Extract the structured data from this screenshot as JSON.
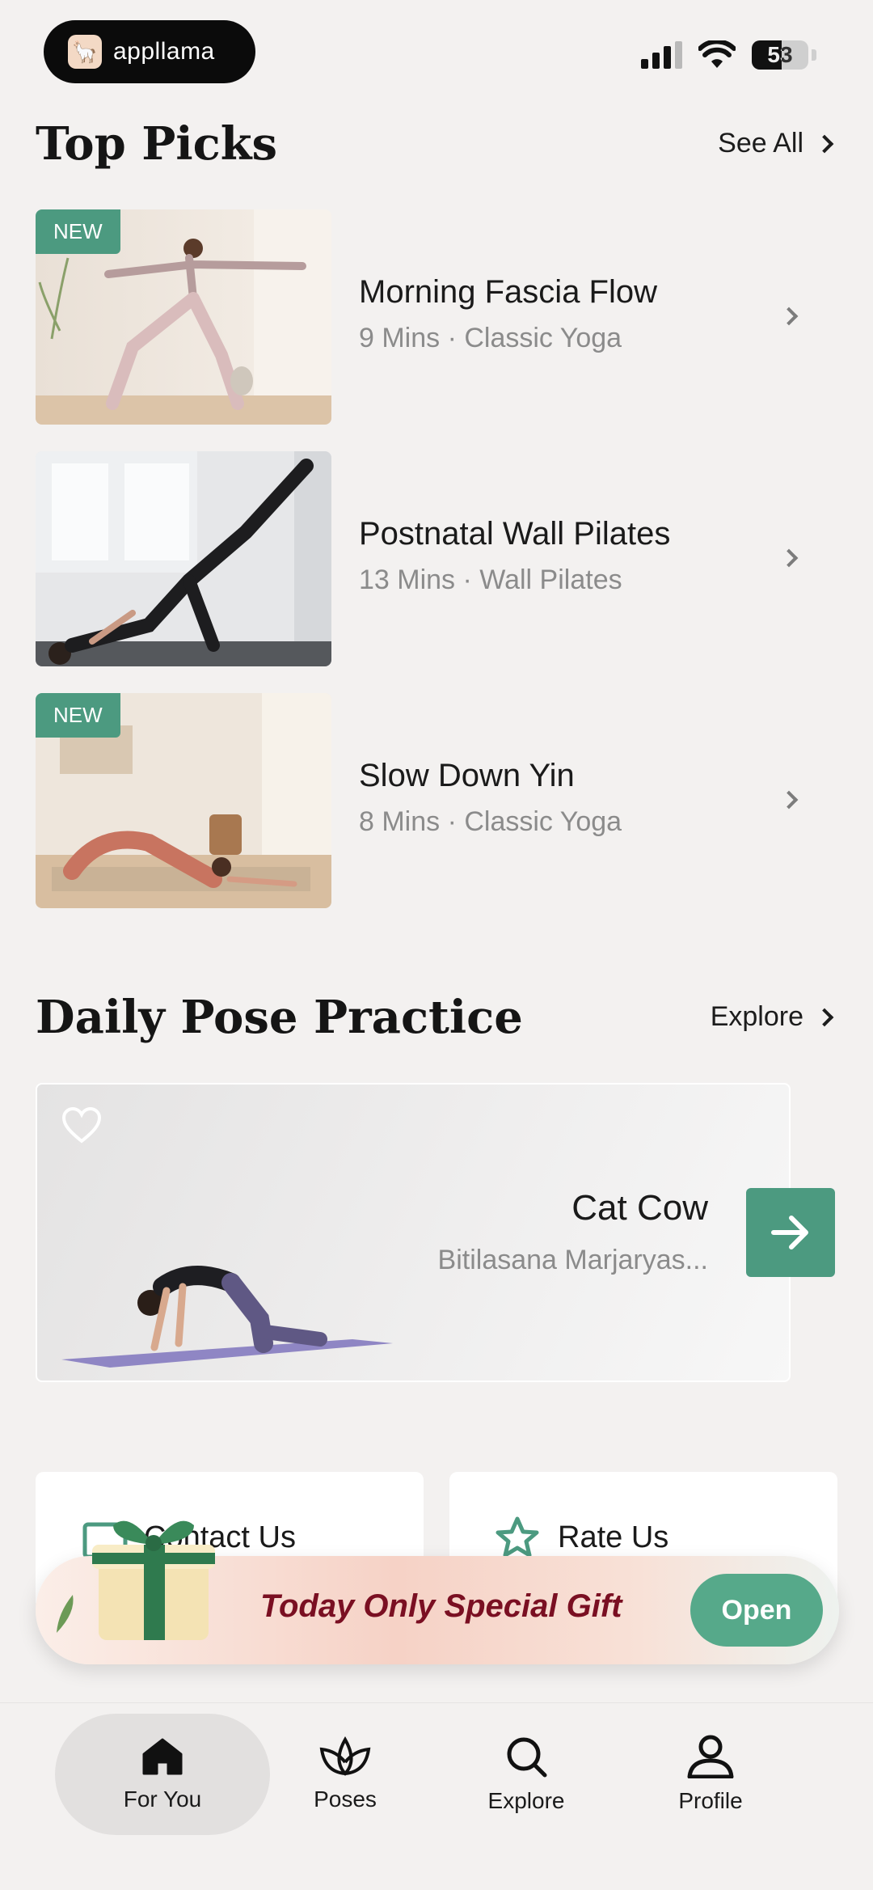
{
  "status_bar": {
    "app_name": "appllama",
    "battery": "53",
    "battery_level": 0.53
  },
  "top_picks": {
    "title": "Top Picks",
    "link_label": "See All",
    "items": [
      {
        "badge": "NEW",
        "title": "Morning Fascia Flow",
        "meta": "9 Mins · Classic Yoga"
      },
      {
        "badge": "",
        "title": "Postnatal Wall Pilates",
        "meta": "13 Mins · Wall Pilates"
      },
      {
        "badge": "NEW",
        "title": "Slow Down Yin",
        "meta": "8 Mins · Classic Yoga"
      }
    ]
  },
  "daily_pose": {
    "title": "Daily Pose Practice",
    "link_label": "Explore",
    "pose_name": "Cat Cow",
    "pose_subtitle": "Bitilasana Marjaryas..."
  },
  "cards": {
    "contact_label": "Contact Us",
    "rate_label": "Rate Us"
  },
  "gift_banner": {
    "text": "Today Only Special Gift",
    "button": "Open"
  },
  "nav": {
    "items": [
      {
        "label": "For You",
        "icon": "home-icon",
        "active": true
      },
      {
        "label": "Poses",
        "icon": "lotus-icon",
        "active": false
      },
      {
        "label": "Explore",
        "icon": "search-icon",
        "active": false
      },
      {
        "label": "Profile",
        "icon": "person-icon",
        "active": false
      }
    ]
  },
  "colors": {
    "background": "#f3f1f0",
    "accent_green": "#4c9a80",
    "gift_text": "#7a0f22"
  }
}
